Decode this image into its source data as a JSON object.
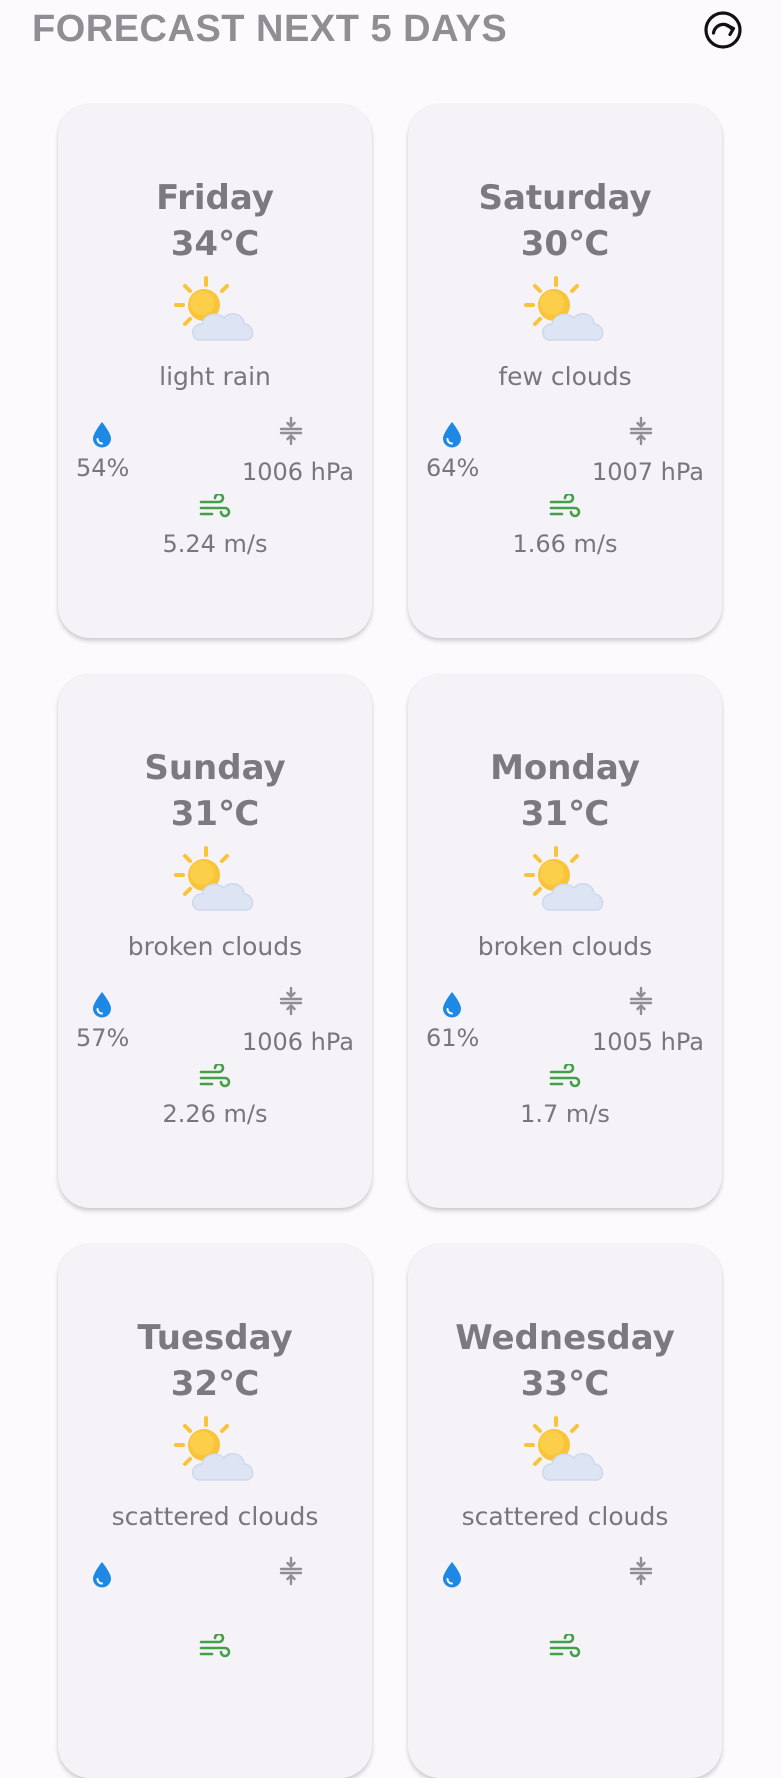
{
  "header": {
    "title": "FORECAST NEXT 5 DAYS",
    "refresh_icon": "refresh-icon"
  },
  "icons": {
    "weather": "partly-cloudy-icon",
    "humidity": "water-drop-icon",
    "pressure": "pressure-icon",
    "wind": "wind-icon"
  },
  "colors": {
    "humidity": "#1e88e5",
    "wind": "#43a047",
    "pressure": "#8f8e92",
    "sun": "#f9c33a",
    "cloud": "#dde4f4"
  },
  "forecast": [
    {
      "day": "Friday",
      "temp": "34℃",
      "desc": "light rain",
      "humidity": "54%",
      "pressure": "1006 hPa",
      "wind": "5.24 m/s"
    },
    {
      "day": "Saturday",
      "temp": "30℃",
      "desc": "few clouds",
      "humidity": "64%",
      "pressure": "1007 hPa",
      "wind": "1.66 m/s"
    },
    {
      "day": "Sunday",
      "temp": "31℃",
      "desc": "broken clouds",
      "humidity": "57%",
      "pressure": "1006 hPa",
      "wind": "2.26 m/s"
    },
    {
      "day": "Monday",
      "temp": "31℃",
      "desc": "broken clouds",
      "humidity": "61%",
      "pressure": "1005 hPa",
      "wind": "1.7 m/s"
    },
    {
      "day": "Tuesday",
      "temp": "32℃",
      "desc": "scattered clouds",
      "humidity": "",
      "pressure": "",
      "wind": ""
    },
    {
      "day": "Wednesday",
      "temp": "33℃",
      "desc": "scattered clouds",
      "humidity": "",
      "pressure": "",
      "wind": ""
    }
  ]
}
